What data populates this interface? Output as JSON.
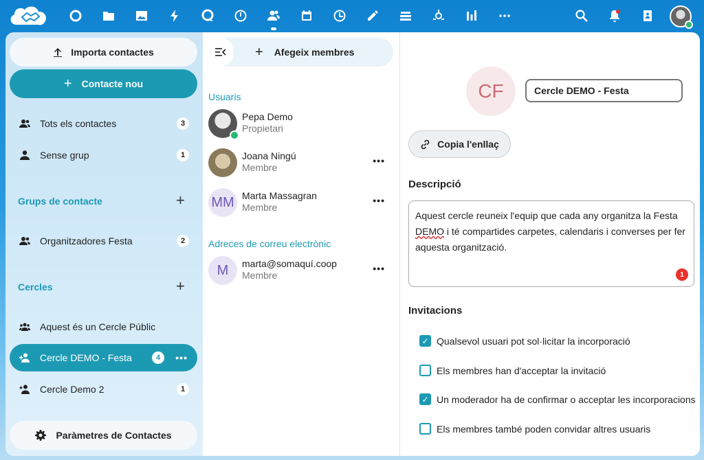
{
  "colors": {
    "primary": "#1d9ab3",
    "status_online": "#2bb873",
    "error": "#e9322d"
  },
  "topbar": {
    "apps": [
      {
        "name": "dashboard-icon"
      },
      {
        "name": "files-icon"
      },
      {
        "name": "photos-icon"
      },
      {
        "name": "activity-icon"
      },
      {
        "name": "talk-icon"
      },
      {
        "name": "deck-icon"
      },
      {
        "name": "contacts-icon",
        "active": true
      },
      {
        "name": "calendar-icon"
      },
      {
        "name": "clock-icon"
      },
      {
        "name": "notes-icon"
      },
      {
        "name": "stack-icon"
      },
      {
        "name": "helper-icon"
      },
      {
        "name": "analytics-icon"
      },
      {
        "name": "more-apps-icon"
      }
    ]
  },
  "nav": {
    "import_label": "Importa contactes",
    "new_contact_label": "Contacte nou",
    "all_contacts": {
      "label": "Tots els contactes",
      "count": "3"
    },
    "no_group": {
      "label": "Sense grup",
      "count": "1"
    },
    "groups_caption": "Grups de contacte",
    "groups": [
      {
        "label": "Organitzadores Festa",
        "count": "2"
      }
    ],
    "circles_caption": "Cercles",
    "circles": [
      {
        "label": "Aquest és un Cercle Públic",
        "count": ""
      },
      {
        "label": "Cercle DEMO - Festa",
        "count": "4",
        "active": true
      },
      {
        "label": "Cercle Demo 2",
        "count": "1"
      }
    ],
    "settings_label": "Paràmetres de Contactes"
  },
  "members": {
    "add_label": "Afegeix membres",
    "users_caption": "Usuaris",
    "users": [
      {
        "name": "Pepa Demo",
        "role": "Propietari"
      },
      {
        "name": "Joana Ningú",
        "role": "Membre"
      },
      {
        "name": "Marta Massagran",
        "role": "Membre",
        "initials": "MM"
      }
    ],
    "emails_caption": "Adreces de correu electrònic",
    "emails": [
      {
        "name": "marta@somaquí.coop",
        "role": "Membre",
        "initials": "M"
      }
    ]
  },
  "details": {
    "initials": "CF",
    "circle_name": "Cercle DEMO - Festa",
    "copy_link_label": "Copia l'enllaç",
    "description_label": "Descripció",
    "description_part1": "Aquest cercle reuneix l'equip que cada any organitza la Festa",
    "description_err": "DEMO",
    "description_part2": " i té compartides carpetes, calendaris i converses per fer aquesta organització.",
    "description_badge": "1",
    "invitations_label": "Invitacions",
    "options": [
      {
        "label": "Qualsevol usuari pot sol·licitar la incorporació",
        "checked": true
      },
      {
        "label": "Els membres han d'acceptar la invitació",
        "checked": false
      },
      {
        "label": "Un moderador ha de confirmar o acceptar les incorporacions",
        "checked": true
      },
      {
        "label": "Els membres també poden convidar altres usuaris",
        "checked": false
      }
    ]
  }
}
